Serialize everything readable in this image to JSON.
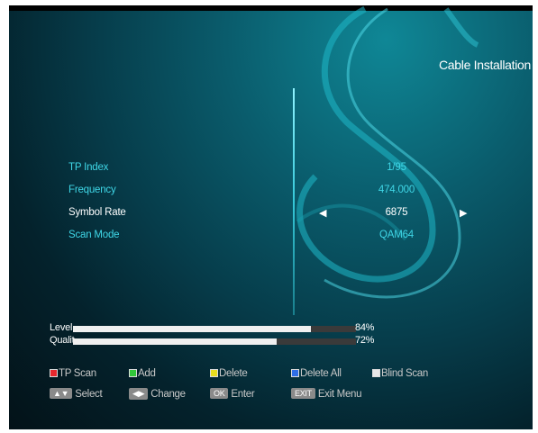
{
  "title": "Cable Installation",
  "fields": [
    {
      "label": "TP Index",
      "value": "1/95",
      "selected": false
    },
    {
      "label": "Frequency",
      "value": "474.000",
      "selected": false
    },
    {
      "label": "Symbol Rate",
      "value": "6875",
      "selected": true
    },
    {
      "label": "Scan Mode",
      "value": "QAM64",
      "selected": false
    }
  ],
  "signal": {
    "level_label": "Level",
    "level_value": "84%",
    "level_fraction": 0.84,
    "quality_label": "Qualit",
    "quality_value": "72%",
    "quality_fraction": 0.72
  },
  "legend": {
    "red_label": "TP Scan",
    "green_label": "Add",
    "yellow_label": "Delete",
    "blue_label": "Delete All",
    "white_label": "Blind Scan",
    "select_label": "Select",
    "change_label": "Change",
    "ok_key": "OK",
    "enter_label": "Enter",
    "exit_key": "EXIT",
    "exit_label": "Exit Menu"
  },
  "colors": {
    "red": "#e8282d",
    "green": "#31c83a",
    "yellow": "#e8de1e",
    "blue": "#2f6ee8",
    "white": "#e8e8e8"
  }
}
